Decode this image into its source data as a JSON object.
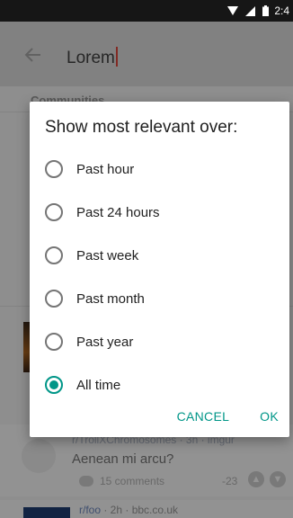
{
  "status_bar": {
    "time": "2:4"
  },
  "toolbar": {
    "search_value": "Lorem"
  },
  "background": {
    "section_label": "Communities",
    "post1": {
      "subreddit": "r/TrollXChromosomes · 3h · imgur",
      "title": "Aenean mi arcu?",
      "comments": "15 comments",
      "score": "-23"
    },
    "post2": {
      "subreddit": "r/foo",
      "meta": " · 2h · bbc.co.uk"
    }
  },
  "dialog": {
    "title": "Show most relevant over:",
    "options": [
      {
        "label": "Past hour",
        "checked": false
      },
      {
        "label": "Past 24 hours",
        "checked": false
      },
      {
        "label": "Past week",
        "checked": false
      },
      {
        "label": "Past month",
        "checked": false
      },
      {
        "label": "Past year",
        "checked": false
      },
      {
        "label": "All time",
        "checked": true
      }
    ],
    "cancel_label": "CANCEL",
    "ok_label": "OK"
  },
  "colors": {
    "accent": "#009688"
  }
}
